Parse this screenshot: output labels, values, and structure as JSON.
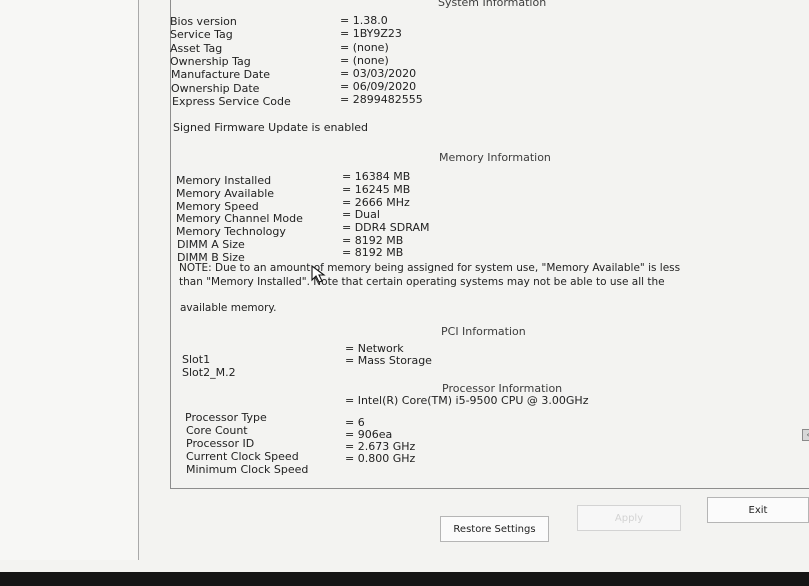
{
  "system_info": {
    "heading": "System Information",
    "rows": [
      {
        "label": "Bios version",
        "value": "= 1.38.0"
      },
      {
        "label": "Service Tag",
        "value": "= 1BY9Z23"
      },
      {
        "label": "Asset Tag",
        "value": "= (none)"
      },
      {
        "label": "Ownership Tag",
        "value": "= (none)"
      },
      {
        "label": "Manufacture Date",
        "value": "= 03/03/2020"
      },
      {
        "label": "Ownership Date",
        "value": "= 06/09/2020"
      },
      {
        "label": "Express Service Code",
        "value": "= 2899482555"
      }
    ],
    "firmware_status": "Signed Firmware Update is enabled"
  },
  "memory_info": {
    "heading": "Memory Information",
    "rows": [
      {
        "label": "Memory Installed",
        "value": "= 16384 MB"
      },
      {
        "label": "Memory Available",
        "value": "= 16245 MB"
      },
      {
        "label": "Memory Speed",
        "value": "= 2666 MHz"
      },
      {
        "label": "Memory Channel Mode",
        "value": "= Dual"
      },
      {
        "label": "Memory Technology",
        "value": "= DDR4 SDRAM"
      },
      {
        "label": "DIMM A Size",
        "value": "= 8192 MB"
      },
      {
        "label": "DIMM B Size",
        "value": "= 8192 MB"
      }
    ],
    "note_lines": [
      "NOTE: Due to an amount of memory being assigned for system use, \"Memory Available\" is less",
      "than \"Memory Installed\". Note that certain operating systems may not be able to use all the",
      "available memory."
    ]
  },
  "pci_info": {
    "heading": "PCI Information",
    "rows": [
      {
        "label": "Slot1",
        "value": "= Network"
      },
      {
        "label": "Slot2_M.2",
        "value": "= Mass Storage"
      }
    ]
  },
  "processor_info": {
    "heading": "Processor Information",
    "rows": [
      {
        "label": "Processor Type",
        "value": "= Intel(R) Core(TM) i5-9500 CPU @ 3.00GHz"
      },
      {
        "label": "Core Count",
        "value": "= 6"
      },
      {
        "label": "Processor ID",
        "value": "= 906ea"
      },
      {
        "label": "Current Clock Speed",
        "value": "= 2.673 GHz"
      },
      {
        "label": "Minimum Clock Speed",
        "value": "= 0.800 GHz"
      }
    ]
  },
  "buttons": {
    "restore_settings": "Restore Settings",
    "apply": "Apply",
    "exit": "Exit"
  },
  "colors": {
    "screen_bg": "#f3f3f1",
    "disabled_text": "#d3d3d3"
  }
}
